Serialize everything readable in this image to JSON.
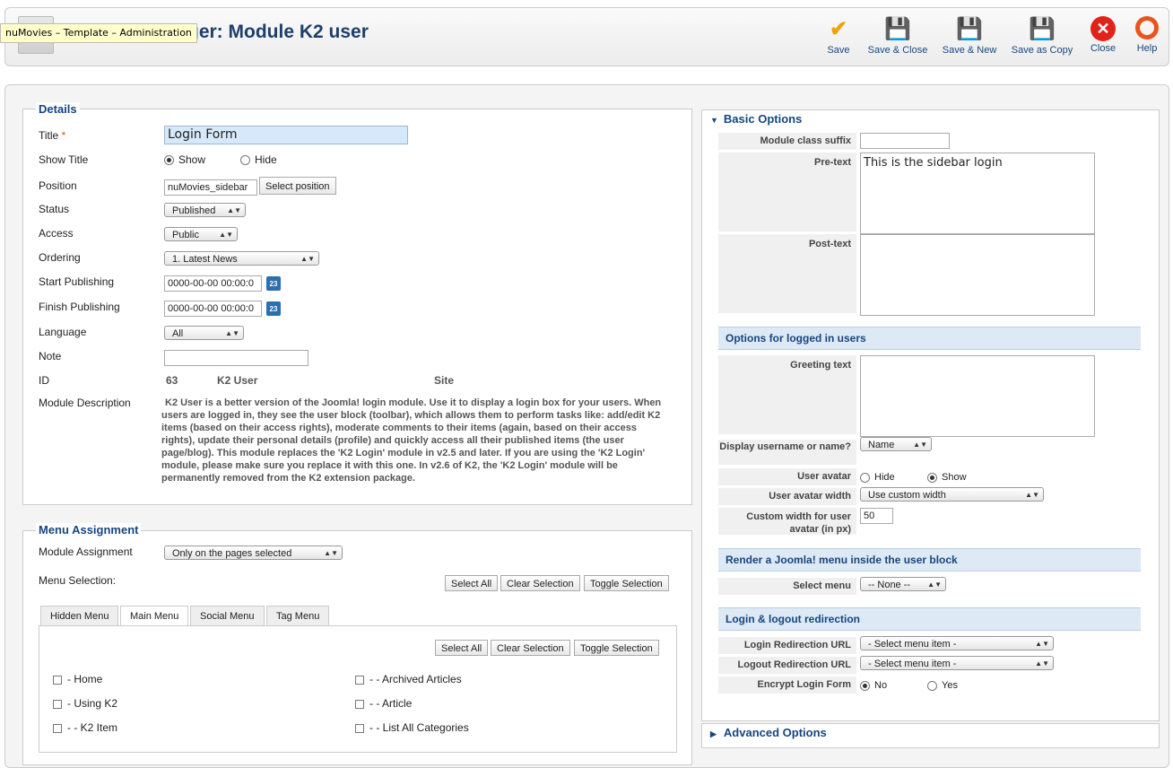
{
  "header": {
    "tooltip": "nuMovies – Template – Administration",
    "title": "ger: Module K2 user",
    "toolbar": {
      "save": "Save",
      "save_close": "Save & Close",
      "save_new": "Save & New",
      "save_copy": "Save as Copy",
      "close": "Close",
      "help": "Help"
    },
    "colors": {
      "title": "#1d3f6b",
      "link": "#16467f",
      "check_accent": "#f0a30a",
      "close_accent": "#e0241a"
    }
  },
  "details": {
    "legend": "Details",
    "title_label": "Title",
    "title_required": "*",
    "title_value": "Login Form",
    "show_title_label": "Show Title",
    "show_title_show": "Show",
    "show_title_hide": "Hide",
    "position_label": "Position",
    "position_value": "nuMovies_sidebar",
    "select_position": "Select position",
    "status_label": "Status",
    "status_value": "Published",
    "access_label": "Access",
    "access_value": "Public",
    "ordering_label": "Ordering",
    "ordering_value": "1. Latest News",
    "start_label": "Start Publishing",
    "start_value": "0000-00-00 00:00:0",
    "finish_label": "Finish Publishing",
    "finish_value": "0000-00-00 00:00:0",
    "calendar_day": "23",
    "language_label": "Language",
    "language_value": "All",
    "note_label": "Note",
    "note_value": "",
    "id_label": "ID",
    "id_value": "63",
    "id_type": "K2 User",
    "id_client": "Site",
    "desc_label": "Module Description",
    "description": "K2 User is a better version of the Joomla! login module. Use it to display a login box for your users. When users are logged in, they see the user block (toolbar), which allows them to perform tasks like: add/edit K2 items (based on their access rights), moderate comments to their items (again, based on their access rights), update their personal details (profile) and quickly access all their published items (the user page/blog). This module replaces the 'K2 Login' module in v2.5 and later. If you are using the 'K2 Login' module, please make sure you replace it with this one. In v2.6 of K2, the 'K2 Login' module will be permanently removed from the K2 extension package."
  },
  "menu": {
    "legend": "Menu Assignment",
    "assignment_label": "Module Assignment",
    "assignment_value": "Only on the pages selected",
    "selection_label": "Menu Selection:",
    "select_all": "Select All",
    "clear_selection": "Clear Selection",
    "toggle_selection": "Toggle Selection",
    "tabs": [
      "Hidden Menu",
      "Main Menu",
      "Social Menu",
      "Tag Menu"
    ],
    "items_left": [
      "- Home",
      "- Using K2",
      "- - K2 Item"
    ],
    "items_right": [
      "- - Archived Articles",
      "- - Article",
      "- - List All Categories"
    ]
  },
  "options": {
    "basic_header": "Basic Options",
    "suffix_label": "Module class suffix",
    "suffix_value": "",
    "pretext_label": "Pre-text",
    "pretext_value": "This is the sidebar login",
    "posttext_label": "Post-text",
    "posttext_value": "",
    "logged_header": "Options for logged in users",
    "greeting_label": "Greeting text",
    "greeting_value": "",
    "display_label": "Display username or name?",
    "display_value": "Name",
    "avatar_label": "User avatar",
    "avatar_hide": "Hide",
    "avatar_show": "Show",
    "avatar_width_label": "User avatar width",
    "avatar_width_value": "Use custom width",
    "custom_width_label": "Custom width for user avatar (in px)",
    "custom_width_value": "50",
    "render_header": "Render a Joomla! menu inside the user block",
    "select_menu_label": "Select menu",
    "select_menu_value": "-- None --",
    "redirect_header": "Login & logout redirection",
    "login_redirect_label": "Login Redirection URL",
    "login_redirect_value": "- Select menu item -",
    "logout_redirect_label": "Logout Redirection URL",
    "logout_redirect_value": "- Select menu item -",
    "encrypt_label": "Encrypt Login Form",
    "encrypt_no": "No",
    "encrypt_yes": "Yes",
    "advanced_header": "Advanced Options"
  }
}
